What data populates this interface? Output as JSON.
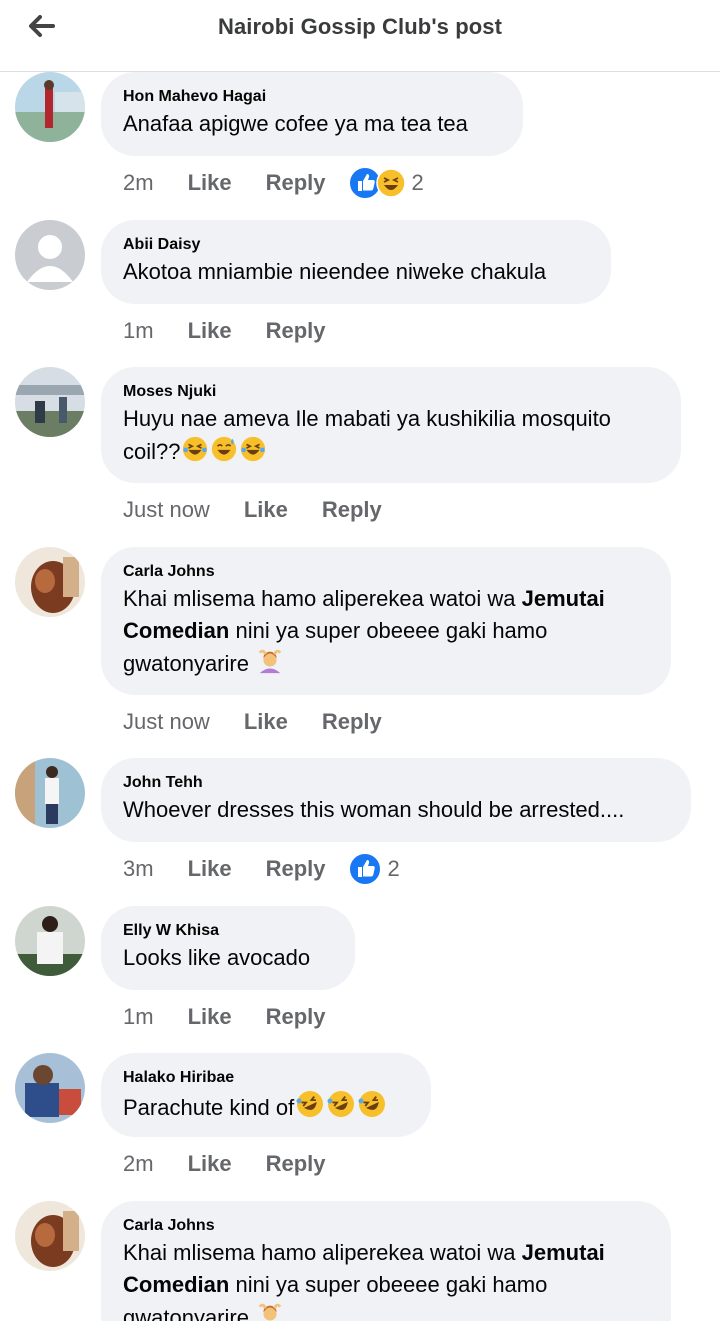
{
  "header": {
    "title": "Nairobi Gossip Club's post"
  },
  "comments": [
    {
      "author": "Hon Mahevo Hagai",
      "text": "Anafaa apigwe cofee ya ma tea tea",
      "time": "2m",
      "like": "Like",
      "reply": "Reply",
      "reactions": "2"
    },
    {
      "author": "Abii Daisy",
      "text": "Akotoa mniambie nieendee niweke chakula",
      "time": "1m",
      "like": "Like",
      "reply": "Reply"
    },
    {
      "author": "Moses Njuki",
      "text_line1": "Huyu nae ameva Ile mabati ya kushikilia mosquito",
      "text_line2": "coil??",
      "time": "Just now",
      "like": "Like",
      "reply": "Reply"
    },
    {
      "author": "Carla Johns",
      "text_a": "Khai mlisema hamo aliperekea watoi wa ",
      "bold_a": "Jemutai",
      "bold_b": "Comedian",
      "text_b": " nini ya super obeeee gaki hamo",
      "text_c": "gwatonyarire ",
      "time": "Just now",
      "like": "Like",
      "reply": "Reply"
    },
    {
      "author": "John Tehh",
      "text": "Whoever dresses this woman should be arrested....",
      "time": "3m",
      "like": "Like",
      "reply": "Reply",
      "reactions": "2"
    },
    {
      "author": "Elly W Khisa",
      "text": "Looks like avocado",
      "time": "1m",
      "like": "Like",
      "reply": "Reply"
    },
    {
      "author": "Halako Hiribae",
      "text": "Parachute kind of",
      "time": "2m",
      "like": "Like",
      "reply": "Reply"
    },
    {
      "author": "Carla Johns",
      "text_a": "Khai mlisema hamo aliperekea watoi wa ",
      "bold_a": "Jemutai",
      "bold_b": "Comedian",
      "text_b": " nini ya super obeeee gaki hamo",
      "text_c": "gwatonyarire "
    }
  ],
  "colors": {
    "bubble": "#f0f2f5",
    "like_blue": "#1877f2",
    "meta_text": "#65676b",
    "header_text": "#3a3b3c"
  },
  "icons": {
    "back": "arrow-left-icon",
    "like_reaction": "thumbs-up-icon",
    "haha_reaction": "laughing-emoji-icon",
    "woman_gesture": "woman-gesturing-icon"
  }
}
